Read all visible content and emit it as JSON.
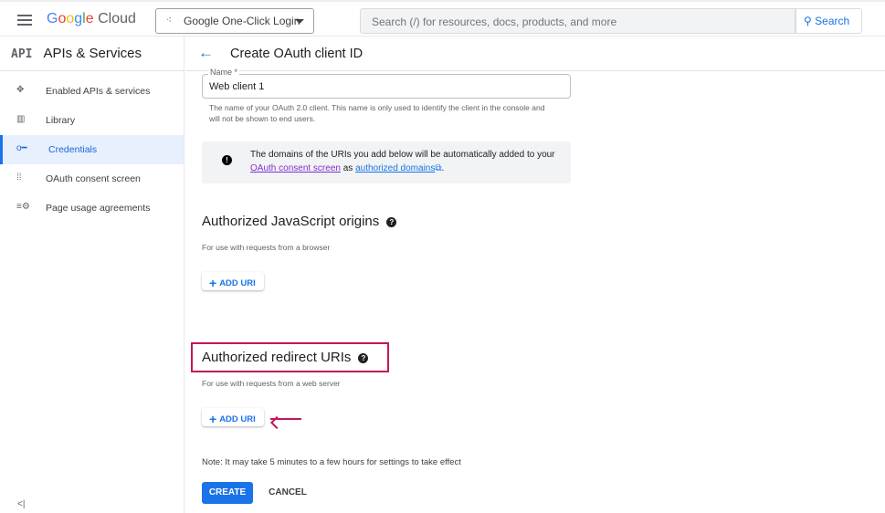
{
  "header": {
    "logo": "Google Cloud",
    "project": "Google One-Click Login",
    "search_placeholder": "Search (/) for resources, docs, products, and more",
    "search_button": "Search"
  },
  "sidebar": {
    "api_badge": "API",
    "title": "APIs & Services",
    "items": [
      {
        "label": "Enabled APIs & services"
      },
      {
        "label": "Library"
      },
      {
        "label": "Credentials",
        "active": true
      },
      {
        "label": "OAuth consent screen"
      },
      {
        "label": "Page usage agreements"
      }
    ],
    "collapse": "<|"
  },
  "page": {
    "title": "Create OAuth client ID",
    "name_label": "Name *",
    "name_value": "Web client 1",
    "name_hint": "The name of your OAuth 2.0 client. This name is only used to identify the client in the console and will not be shown to end users.",
    "info": {
      "pre": "The domains of the URIs you add below will be automatically added to your ",
      "link1": "OAuth consent screen",
      "mid": " as ",
      "link2": "authorized domains",
      "post": "."
    },
    "js_origins": {
      "title": "Authorized JavaScript origins",
      "sub": "For use with requests from a browser",
      "add": "ADD URI"
    },
    "redirect": {
      "title": "Authorized redirect URIs",
      "sub": "For use with requests from a web server",
      "add": "ADD URI"
    },
    "note": "Note: It may take 5 minutes to a few hours for settings to take effect",
    "create": "CREATE",
    "cancel": "CANCEL"
  },
  "colors": {
    "accent": "#1a73e8",
    "highlight": "#c2185b"
  }
}
